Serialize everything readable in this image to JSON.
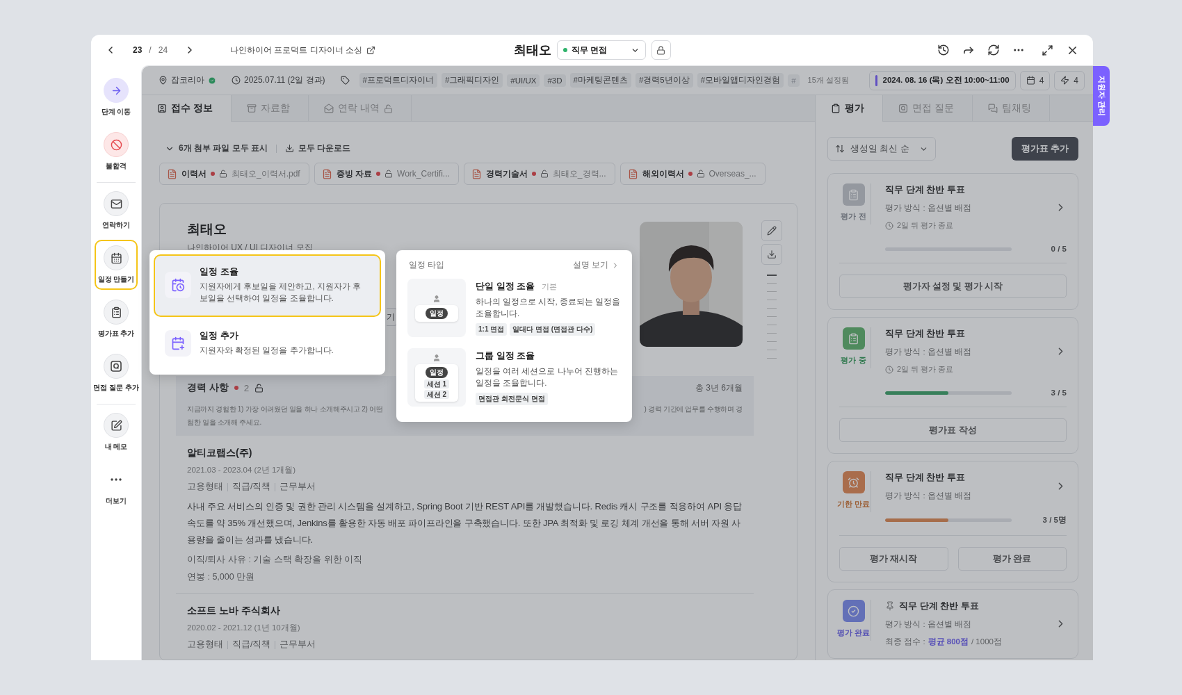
{
  "nav": {
    "page": "23",
    "separator": "/",
    "total": "24"
  },
  "header": {
    "job_link": "나인하이어 프로덕트 디자이너 소싱",
    "candidate": "최태오",
    "stage": "직무 면접"
  },
  "side_tab": "지원자 관리",
  "sidebar": [
    [
      {
        "label": "단계 이동",
        "kind": "primary",
        "selected": false
      },
      {
        "label": "불합격",
        "kind": "danger",
        "selected": false
      }
    ],
    [
      {
        "label": "연락하기",
        "kind": "normal",
        "selected": false
      },
      {
        "label": "일정 만들기",
        "kind": "normal",
        "selected": true
      },
      {
        "label": "평가표 추가",
        "kind": "normal",
        "selected": false
      },
      {
        "label": "면접 질문 추가",
        "kind": "normal",
        "selected": false
      }
    ],
    [
      {
        "label": "내 메모",
        "kind": "normal",
        "selected": false
      },
      {
        "label": "더보기",
        "kind": "plain",
        "selected": false
      }
    ]
  ],
  "info_bar": {
    "source": "잡코리아",
    "verified": true,
    "applied": "2025.07.11 (2일 경과)",
    "tags": [
      {
        "text": "#프로덕트디자이너",
        "faded": false
      },
      {
        "text": "#그래픽디자인",
        "faded": false
      },
      {
        "text": "#UI/UX",
        "faded": false
      },
      {
        "text": "#3D",
        "faded": false
      },
      {
        "text": "#마케팅콘텐츠",
        "faded": false
      },
      {
        "text": "#경력5년이상",
        "faded": false
      },
      {
        "text": "#모바일앱디자인경험",
        "faded": false
      },
      {
        "text": "#",
        "faded": true
      }
    ],
    "tag_more": "15개 설정됨",
    "schedule": "2024. 08. 16 (목) 오전 10:00~11:00",
    "schedule_count": "4",
    "action_count": "4"
  },
  "left_tabs": [
    {
      "label": "접수 정보",
      "selected": true,
      "locked": false
    },
    {
      "label": "자료함",
      "selected": false,
      "locked": false
    },
    {
      "label": "연락 내역",
      "selected": false,
      "locked": true
    }
  ],
  "attachments": {
    "toggle": "6개 첨부 파일 모두 표시",
    "download": "모두 다운로드",
    "files": [
      {
        "type": "이력서",
        "name": "최태오_이력서.pdf",
        "required": true
      },
      {
        "type": "증빙 자료",
        "name": "Work_Certifi...",
        "required": true
      },
      {
        "type": "경력기술서",
        "name": "최태오_경력...",
        "required": true
      },
      {
        "type": "해외이력서",
        "name": "Overseas_...",
        "required": true
      }
    ]
  },
  "profile": {
    "name": "최태오",
    "subtitle": "나인하이어 UX / UI 디자이너 모집",
    "button_fragment": "기"
  },
  "career": {
    "title": "경력 사항",
    "required": true,
    "count": "2",
    "total": "총 3년 6개월",
    "prompt_left": "지금까지 경험한 1) 가장 어려웠던 일을 하나 소개해주시고 2) 어떤",
    "prompt_right": ") 경력 기간에 업무를 수행하며 경",
    "prompt_line2": "험한 일을 소개해 주세요.",
    "entries": [
      {
        "company": "알티코랩스(주)",
        "period": "2021.03 - 2023.04 (2년 1개월)",
        "meta": [
          "고용형태",
          "직급/직책",
          "근무부서"
        ],
        "description": "사내 주요 서비스의 인증 및 권한 관리 시스템을 설계하고, Spring Boot 기반 REST API를 개발했습니다. Redis 캐시 구조를 적용하여 API 응답 속도를 약 35% 개선했으며, Jenkins를 활용한 자동 배포 파이프라인을 구축했습니다. 또한 JPA 최적화 및 로깅 체계 개선을 통해 서버 자원 사용량을 줄이는 성과를 냈습니다.",
        "reason": "이직/퇴사 사유 : 기술 스택 확장을 위한 이직",
        "salary": "연봉 : 5,000 만원"
      },
      {
        "company": "소프트 노바 주식회사",
        "period": "2020.02 - 2021.12 (1년 10개월)",
        "meta": [
          "고용형태",
          "직급/직책",
          "근무부서"
        ]
      }
    ]
  },
  "schedule_menu": {
    "options": [
      {
        "title": "일정 조율",
        "description": "지원자에게 후보일을 제안하고, 지원자가 후보일을 선택하여 일정을 조율합니다.",
        "selected": true
      },
      {
        "title": "일정 추가",
        "description": "지원자와 확정된 일정을 추가합니다.",
        "selected": false
      }
    ]
  },
  "schedule_types": {
    "title": "일정 타입",
    "help": "설명 보기",
    "types": [
      {
        "name": "단일 일정 조율",
        "badge": "기본",
        "description": "하나의 일정으로 시작, 종료되는 일정을 조율합니다.",
        "tags": [
          "1:1 면접",
          "일대다 면접 (면접관 다수)"
        ],
        "chip": "일정"
      },
      {
        "name": "그룹 일정 조율",
        "description": "일정을 여러 세션으로 나누어 진행하는 일정을 조율합니다.",
        "tags": [
          "면접관 회전문식 면접"
        ],
        "chip": "일정",
        "sessions": [
          "세션 1",
          "세션 2"
        ]
      }
    ]
  },
  "right_tabs": [
    {
      "label": "평가",
      "selected": true
    },
    {
      "label": "면접 질문",
      "selected": false
    },
    {
      "label": "팀채팅",
      "selected": false
    }
  ],
  "sort": "생성일 최신 순",
  "add_button": "평가표 추가",
  "evaluations": [
    {
      "kind": "before",
      "status": "평가 전",
      "pinned": false,
      "title": "직무 단계 찬반 투표",
      "method": "평가 방식 : 옵션별 배점",
      "deadline": "2일 뒤 평가 종료",
      "level": 0,
      "count": "0 / 5",
      "actions": [
        "평가자 설정 및 평가 시작"
      ]
    },
    {
      "kind": "ongoing",
      "status": "평가 중",
      "pinned": false,
      "title": "직무 단계 찬반 투표",
      "method": "평가 방식 : 옵션별 배점",
      "deadline": "2일 뒤 평가 종료",
      "level": 0.5,
      "count": "3 / 5",
      "actions": [
        "평가표 작성"
      ]
    },
    {
      "kind": "expired",
      "status": "기한 만료",
      "pinned": false,
      "title": "직무 단계 찬반 투표",
      "method": "평가 방식 : 옵션별 배점",
      "level": 0.5,
      "count": "3 / 5명",
      "actions": [
        "평가 재시작",
        "평가 완료"
      ]
    },
    {
      "kind": "done",
      "status": "평가 완료",
      "pinned": true,
      "title": "직무 단계 찬반 투표",
      "method": "평가 방식 : 옵션별 배점",
      "score_label": "최종 점수 :",
      "score_value": "평균 800점",
      "score_total": "/ 1000점"
    }
  ]
}
